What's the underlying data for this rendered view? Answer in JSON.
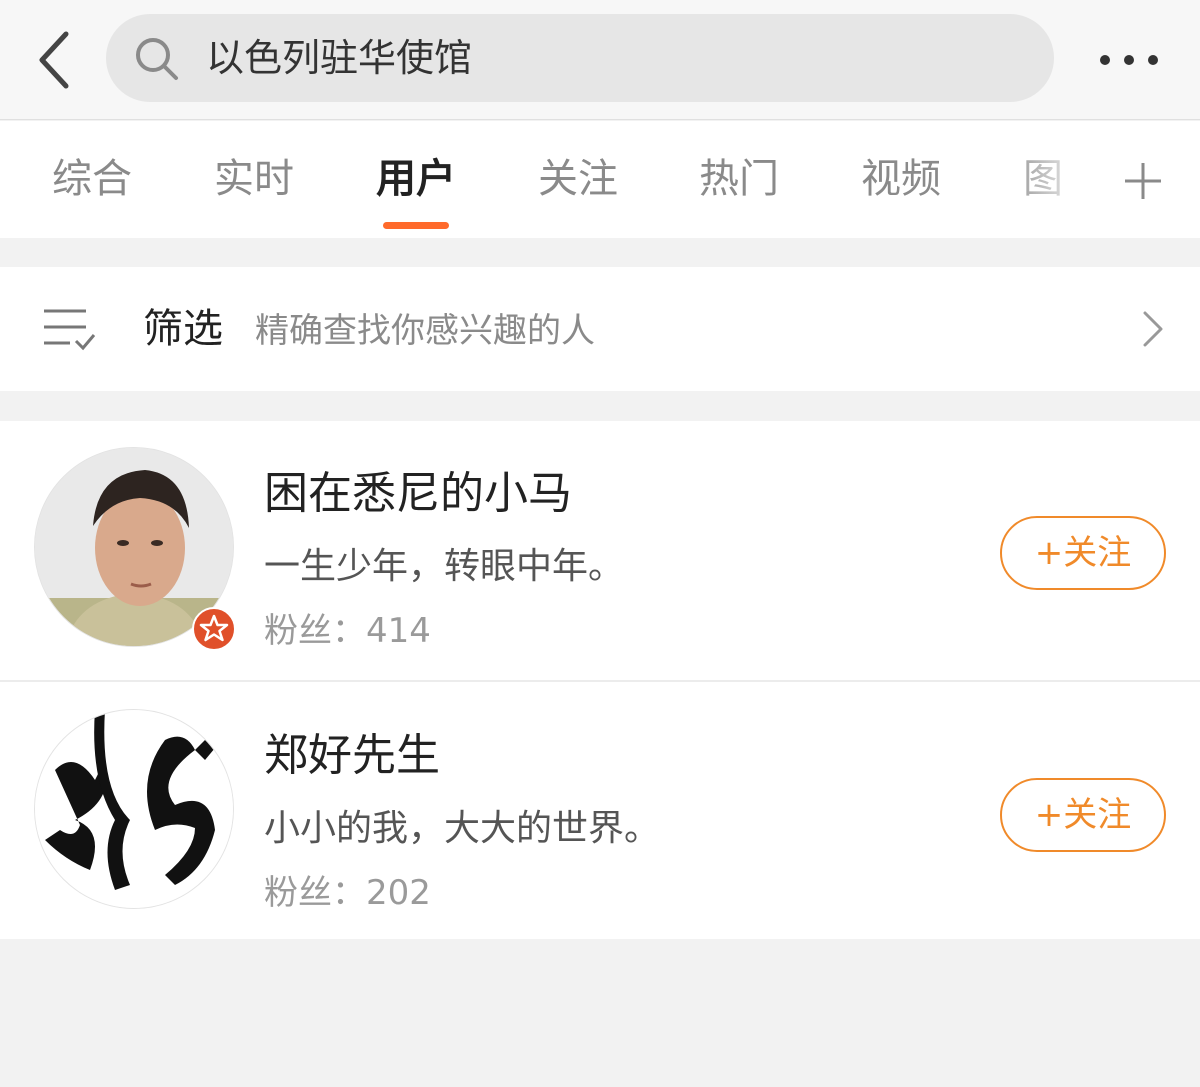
{
  "header": {
    "search_query": "以色列驻华使馆"
  },
  "tabs": [
    {
      "label": "综合"
    },
    {
      "label": "实时"
    },
    {
      "label": "用户"
    },
    {
      "label": "关注"
    },
    {
      "label": "热门"
    },
    {
      "label": "视频"
    },
    {
      "label": "图"
    }
  ],
  "active_tab": "用户",
  "filter": {
    "label": "筛选",
    "hint": "精确查找你感兴趣的人"
  },
  "users": [
    {
      "name": "困在悉尼的小马",
      "bio": "一生少年，转眼中年。",
      "fans_label": "粉丝：",
      "fans_count": "414",
      "follow_label": "+关注"
    },
    {
      "name": "郑好先生",
      "bio": "小小的我，大大的世界。",
      "fans_label": "粉丝：",
      "fans_count": "202",
      "follow_label": "+关注"
    }
  ],
  "colors": {
    "accent": "#ff6a2b",
    "follow": "#f08a2a",
    "badge": "#e0502a"
  },
  "icons": [
    "back-icon",
    "search-icon",
    "more-icon",
    "add-tab-icon",
    "filter-icon",
    "chevron-right-icon",
    "verified-badge-icon"
  ]
}
